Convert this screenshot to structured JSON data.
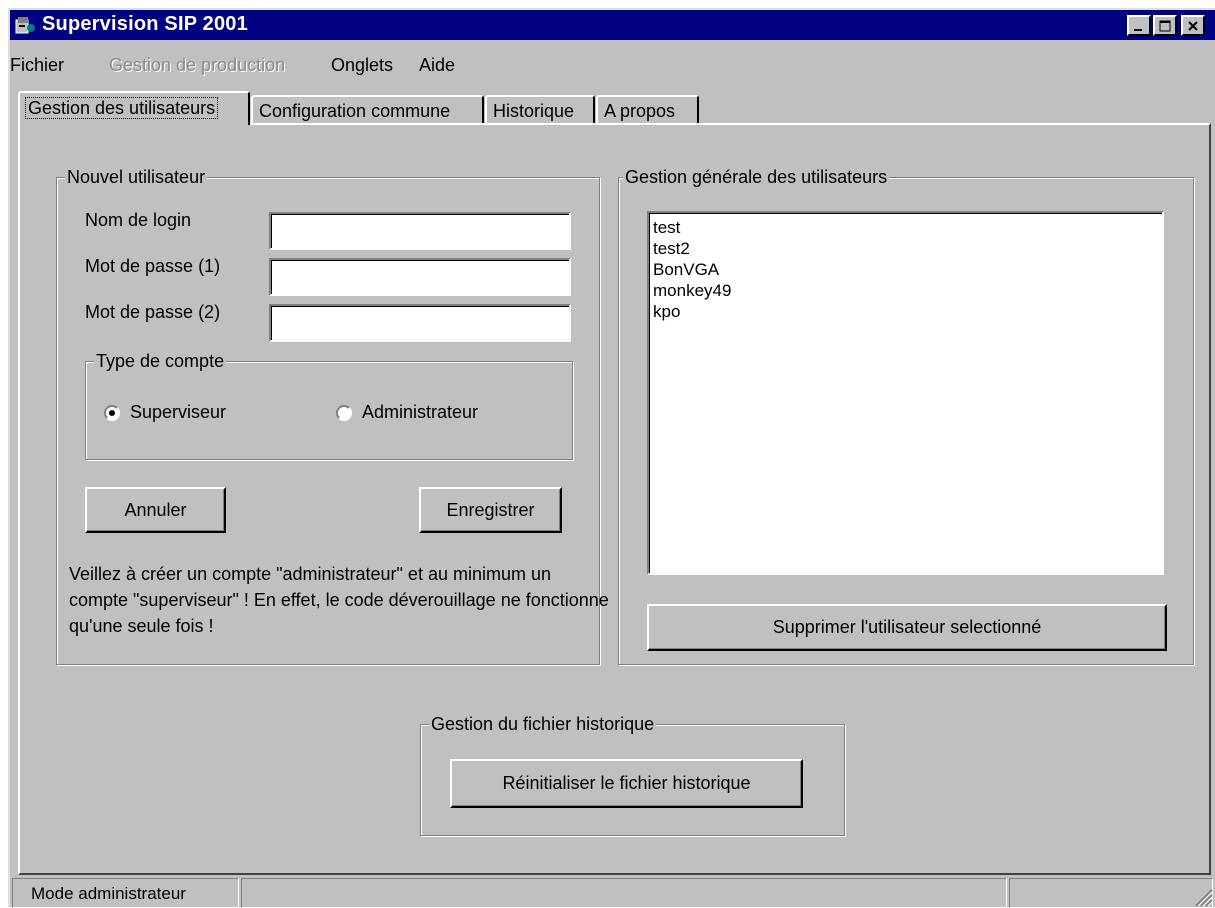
{
  "window": {
    "title": "Supervision SIP 2001",
    "minimize_icon": "minimize-icon",
    "maximize_icon": "maximize-icon",
    "close_icon": "close-icon",
    "title_bar_color": "#000080",
    "face_color": "#c0c0c0"
  },
  "menu": {
    "items": [
      {
        "label": "Fichier",
        "enabled": true
      },
      {
        "label": "Gestion de production",
        "enabled": false
      },
      {
        "label": "Onglets",
        "enabled": true
      },
      {
        "label": "Aide",
        "enabled": true
      }
    ]
  },
  "tabs": [
    {
      "label": "Gestion des utilisateurs",
      "active": true
    },
    {
      "label": "Configuration commune",
      "active": false
    },
    {
      "label": "Historique",
      "active": false
    },
    {
      "label": "A propos",
      "active": false
    }
  ],
  "new_user": {
    "legend": "Nouvel utilisateur",
    "login_label": "Nom de login",
    "login_value": "",
    "password1_label": "Mot de passe (1)",
    "password1_value": "",
    "password2_label": "Mot de passe (2)",
    "password2_value": "",
    "account_type": {
      "legend": "Type de compte",
      "options": [
        {
          "label": "Superviseur",
          "checked": true
        },
        {
          "label": "Administrateur",
          "checked": false
        }
      ]
    },
    "cancel_label": "Annuler",
    "save_label": "Enregistrer",
    "note": "Veillez à créer un compte \"administrateur\" et au minimum un compte \"superviseur\" ! En effet, le code déverouillage ne fonctionne qu'une seule fois !"
  },
  "user_management": {
    "legend": "Gestion générale des utilisateurs",
    "users": [
      "test",
      "test2",
      "BonVGA",
      "monkey49",
      "kpo"
    ],
    "delete_label": "Supprimer l'utilisateur selectionné"
  },
  "history": {
    "legend": "Gestion du fichier historique",
    "reset_label": "Réinitialiser le fichier historique"
  },
  "statusbar": {
    "mode": "Mode administrateur",
    "cell2": "",
    "cell3": ""
  }
}
